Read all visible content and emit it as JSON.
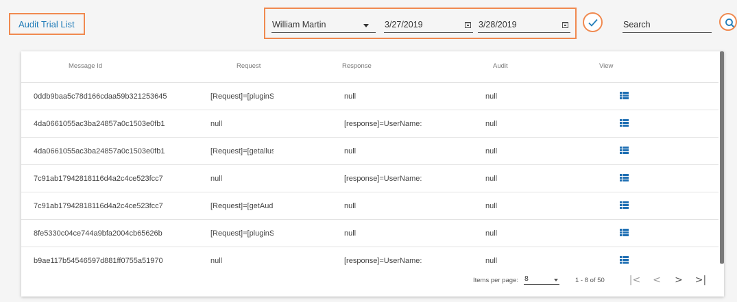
{
  "header": {
    "title": "Audit Trial List",
    "user_value": "William Martin",
    "start_date": "3/27/2019",
    "end_date": "3/28/2019",
    "search_placeholder": "Search"
  },
  "table": {
    "columns": [
      "Message Id",
      "Request",
      "Response",
      "Audit",
      "View"
    ],
    "rows": [
      {
        "message_id": "0ddb9baa5c78d166cdaa59b321253645",
        "request": "[Request]=[pluginServ",
        "response": "null",
        "audit": "null"
      },
      {
        "message_id": "4da0661055ac3ba24857a0c1503e0fb1",
        "request": "null",
        "response": "[response]=UserName:",
        "audit": "null"
      },
      {
        "message_id": "4da0661055ac3ba24857a0c1503e0fb1",
        "request": "[Request]=[getalluser",
        "response": "null",
        "audit": "null"
      },
      {
        "message_id": "7c91ab17942818116d4a2c4ce523fcc7",
        "request": "null",
        "response": "[response]=UserName:",
        "audit": "null"
      },
      {
        "message_id": "7c91ab17942818116d4a2c4ce523fcc7",
        "request": "[Request]=[getAuditTr",
        "response": "null",
        "audit": "null"
      },
      {
        "message_id": "8fe5330c04ce744a9bfa2004cb65626b",
        "request": "[Request]=[pluginServ",
        "response": "null",
        "audit": "null"
      },
      {
        "message_id": "b9ae117b54546597d881ff0755a51970",
        "request": "null",
        "response": "[response]=UserName:",
        "audit": "null"
      }
    ]
  },
  "paginator": {
    "items_per_page_label": "Items per page:",
    "items_per_page_value": "8",
    "range_label": "1 - 8 of 50",
    "first_glyph": "|<",
    "prev_glyph": "<",
    "next_glyph": ">",
    "last_glyph": ">|"
  },
  "colors": {
    "accent_orange": "#f0894f",
    "link_blue": "#1f7bb8",
    "icon_blue": "#1f6fb3"
  }
}
